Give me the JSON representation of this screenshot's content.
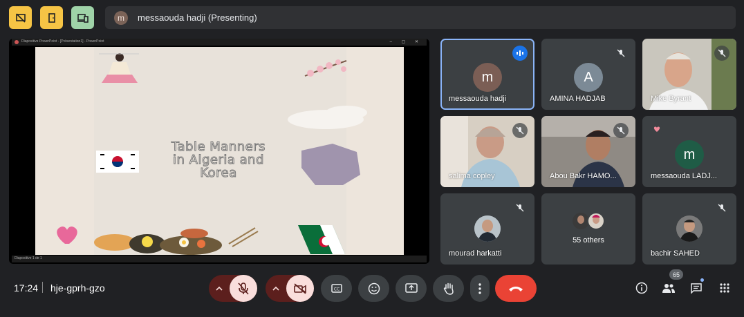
{
  "top_bar": {
    "presenter_avatar_letter": "m",
    "presenter_text": "messaouda hadji (Presenting)"
  },
  "presentation": {
    "window_title": "Diapositive PowerPoint - [Présentation1] - PowerPoint",
    "slide_title_line1": "Table Manners",
    "slide_title_line2": "in Algeria and",
    "slide_title_line3": "Korea",
    "status_text": "Diapositive 1 de 1"
  },
  "tiles": [
    {
      "name": "messaouda hadji",
      "avatar": "m",
      "avatar_color": "#7b5e55",
      "state": "speaking"
    },
    {
      "name": "AMINA HADJAB",
      "avatar": "A",
      "avatar_color": "#7c8a96",
      "state": "muted"
    },
    {
      "name": "Mike Byrant",
      "state": "muted"
    },
    {
      "name": "salima copley",
      "state": "muted"
    },
    {
      "name": "Abou Bakr HAMO...",
      "state": "muted"
    },
    {
      "name": "messaouda LADJ...",
      "avatar": "m",
      "avatar_color": "#1f5c46",
      "state": "reaction"
    },
    {
      "name": "mourad harkatti",
      "state": "muted"
    },
    {
      "name": "55 others",
      "state": "group"
    },
    {
      "name": "bachir SAHED",
      "state": "muted"
    }
  ],
  "bottom_bar": {
    "time": "17:24",
    "meeting_code": "hje-gprh-gzo",
    "participants_count": "65"
  },
  "colors": {
    "background": "#202124",
    "tile": "#3c4043",
    "active_outline": "#8ab4f8",
    "end_call": "#ea4335",
    "muted_control": "#f9dedc"
  }
}
